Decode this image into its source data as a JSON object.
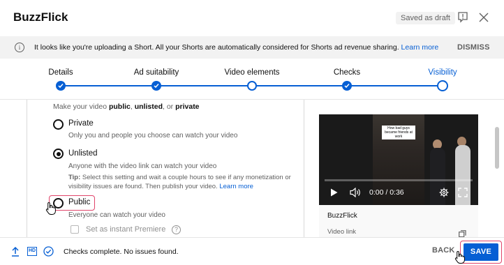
{
  "header": {
    "title": "BuzzFlick",
    "draft_badge": "Saved as draft"
  },
  "banner": {
    "text": "It looks like you're uploading a Short. All your Shorts are automatically considered for Shorts ad revenue sharing.",
    "link": "Learn more",
    "dismiss": "DISMISS"
  },
  "stepper": {
    "steps": [
      {
        "label": "Details",
        "state": "done"
      },
      {
        "label": "Ad suitability",
        "state": "done"
      },
      {
        "label": "Video elements",
        "state": "pending"
      },
      {
        "label": "Checks",
        "state": "done"
      },
      {
        "label": "Visibility",
        "state": "current"
      }
    ],
    "accent": "#065fd4"
  },
  "visibility": {
    "intro_prefix": "Make your video",
    "intro_public": "public",
    "intro_sep": ",",
    "intro_unlisted": "unlisted",
    "intro_or": ", or",
    "intro_private": "private",
    "options": [
      {
        "label": "Private",
        "desc": "Only you and people you choose can watch your video",
        "checked": false
      },
      {
        "label": "Unlisted",
        "desc": "Anyone with the video link can watch your video",
        "checked": true
      },
      {
        "label": "Public",
        "desc": "Everyone can watch your video",
        "checked": false
      }
    ],
    "tip_label": "Tip:",
    "tip_text": "Select this setting and wait a couple hours to see if any monetization or visibility issues are found. Then publish your video.",
    "tip_link": "Learn more",
    "premiere_label": "Set as instant Premiere",
    "help_glyph": "?"
  },
  "video": {
    "caption": "How bad guys became friends at work",
    "time": "0:00 / 0:36",
    "name": "BuzzFlick",
    "link_label": "Video link"
  },
  "footer": {
    "hd_label": "HD",
    "status": "Checks complete. No issues found.",
    "back_label": "BACK",
    "save_label": "SAVE"
  },
  "colors": {
    "accent": "#065fd4",
    "highlight": "#e0446a"
  },
  "icons": {
    "banner": "info-icon",
    "feedback": "feedback-icon",
    "close": "close-icon"
  }
}
